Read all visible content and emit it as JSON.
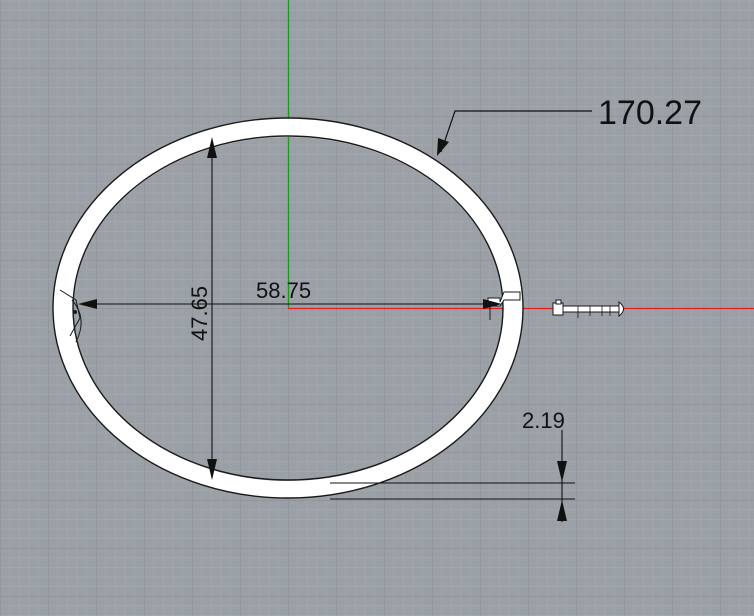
{
  "dimensions": {
    "perimeter": "170.27",
    "width": "58.75",
    "height": "47.65",
    "thickness": "2.19"
  },
  "colors": {
    "background": "#9aa0a6",
    "grid_minor": "#a7adb3",
    "grid_major": "#8a9096",
    "x_axis": "#e02020",
    "y_axis": "#1a9a1a",
    "ring_fill": "#ffffff",
    "ring_outline": "#1a1a1a",
    "dimension_line": "#111111"
  }
}
